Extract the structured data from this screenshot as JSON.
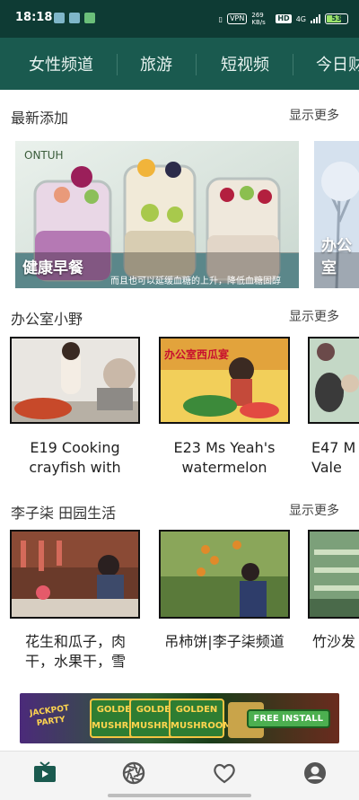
{
  "status_bar": {
    "time": "18:18",
    "vpn": "VPN",
    "net_speed": "269 KB/s",
    "hd": "HD",
    "network": "4G",
    "battery": "53"
  },
  "tabs": [
    "女性频道",
    "旅游",
    "短视频",
    "今日财"
  ],
  "sections": [
    {
      "title": "最新添加",
      "more": "显示更多",
      "cards": [
        {
          "label": "健康早餐",
          "subtitle": "而且也可以延缓血糖的上升，降低血糖固醇",
          "logo": "ONTUH"
        },
        {
          "label": "办公室"
        }
      ]
    },
    {
      "title": "办公室小野",
      "more": "显示更多",
      "cards": [
        {
          "caption": "E19 Cooking crayfish with"
        },
        {
          "caption": "E23 Ms Yeah's watermelon",
          "thumb_text": "办公室西瓜宴"
        },
        {
          "caption": "E47 M Vale"
        }
      ]
    },
    {
      "title": "李子柒 田园生活",
      "more": "显示更多",
      "cards": [
        {
          "caption": "花生和瓜子，肉干，水果干，雪"
        },
        {
          "caption": "吊柿饼|李子柒频道"
        },
        {
          "caption": "竹沙发"
        }
      ]
    }
  ],
  "ad": {
    "left_text": "JACKPOT PARTY",
    "badges": [
      "GOLDEN MUSHROOM",
      "GOLDEN MUSHROOM",
      "GOLDEN MUSHROOM"
    ],
    "install": "FREE INSTALL"
  },
  "bottom_nav": [
    "tv-icon",
    "aperture-icon",
    "heart-icon",
    "account-icon"
  ],
  "colors": {
    "header": "#1a5a4f",
    "status": "#0e3b34",
    "active_nav": "#1a5a4f"
  }
}
